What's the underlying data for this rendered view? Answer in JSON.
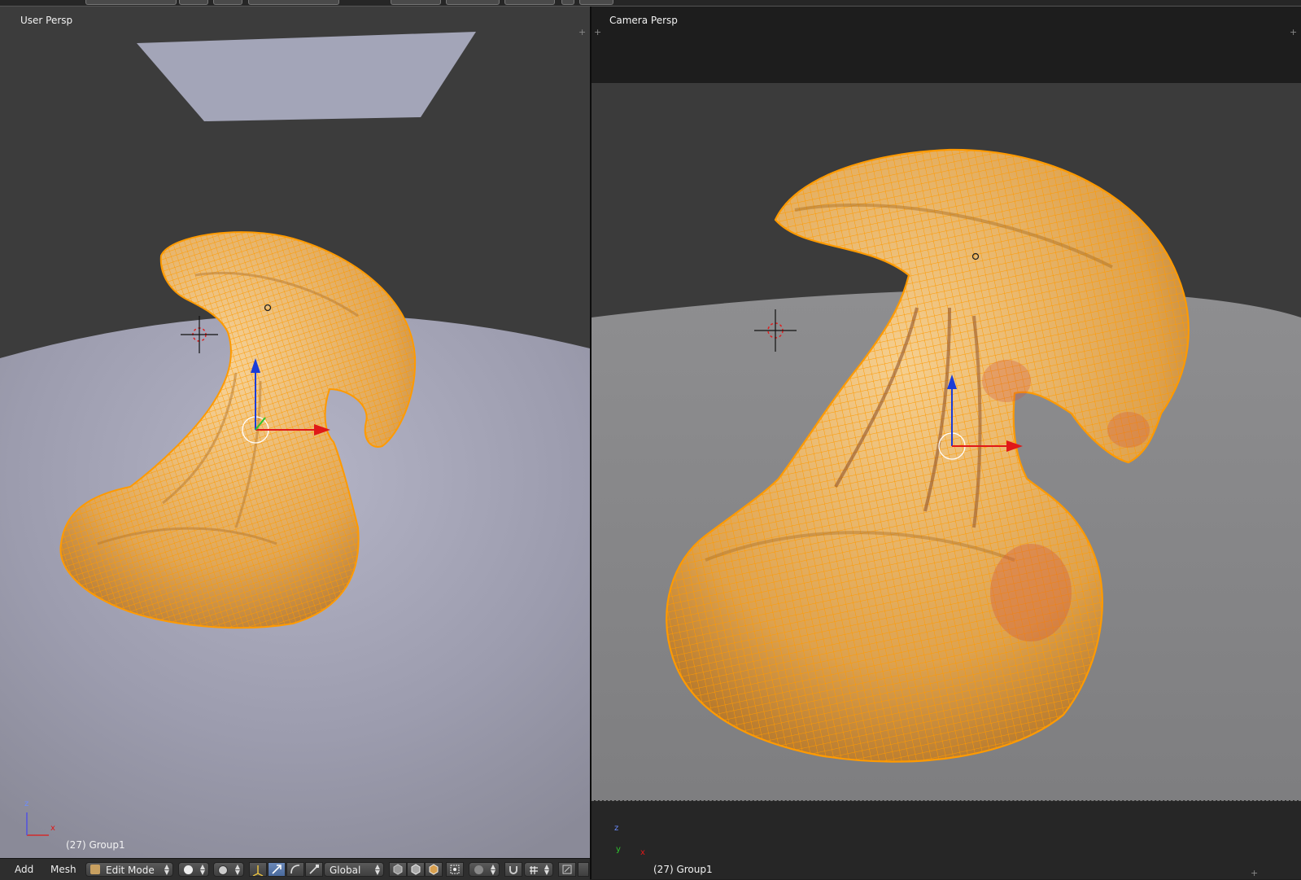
{
  "viewports": {
    "left": {
      "label": "User Persp",
      "group": "(27) Group1"
    },
    "right": {
      "label": "Camera Persp",
      "group": "(27) Group1"
    }
  },
  "axes": {
    "z": "z",
    "x": "x",
    "y": "y"
  },
  "header": {
    "add": "Add",
    "mesh": "Mesh",
    "mode": "Edit Mode",
    "orientation": "Global"
  },
  "colors": {
    "mesh_orange": "#f5a623",
    "wire": "#ff9a00",
    "floor_left": "#9a9aa8",
    "floor_right": "#8a8a8e",
    "axis_x": "#e01818",
    "axis_z": "#1a3cd8",
    "axis_y": "#2ec42e"
  }
}
